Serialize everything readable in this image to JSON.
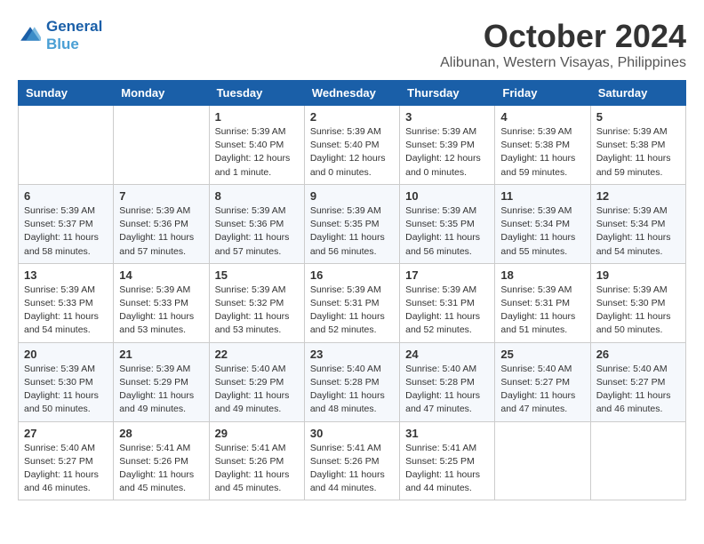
{
  "logo": {
    "line1": "General",
    "line2": "Blue"
  },
  "title": "October 2024",
  "location": "Alibunan, Western Visayas, Philippines",
  "weekdays": [
    "Sunday",
    "Monday",
    "Tuesday",
    "Wednesday",
    "Thursday",
    "Friday",
    "Saturday"
  ],
  "weeks": [
    [
      {
        "day": null
      },
      {
        "day": null
      },
      {
        "day": "1",
        "sunrise": "5:39 AM",
        "sunset": "5:40 PM",
        "daylight": "12 hours and 1 minute."
      },
      {
        "day": "2",
        "sunrise": "5:39 AM",
        "sunset": "5:40 PM",
        "daylight": "12 hours and 0 minutes."
      },
      {
        "day": "3",
        "sunrise": "5:39 AM",
        "sunset": "5:39 PM",
        "daylight": "12 hours and 0 minutes."
      },
      {
        "day": "4",
        "sunrise": "5:39 AM",
        "sunset": "5:38 PM",
        "daylight": "11 hours and 59 minutes."
      },
      {
        "day": "5",
        "sunrise": "5:39 AM",
        "sunset": "5:38 PM",
        "daylight": "11 hours and 59 minutes."
      }
    ],
    [
      {
        "day": "6",
        "sunrise": "5:39 AM",
        "sunset": "5:37 PM",
        "daylight": "11 hours and 58 minutes."
      },
      {
        "day": "7",
        "sunrise": "5:39 AM",
        "sunset": "5:36 PM",
        "daylight": "11 hours and 57 minutes."
      },
      {
        "day": "8",
        "sunrise": "5:39 AM",
        "sunset": "5:36 PM",
        "daylight": "11 hours and 57 minutes."
      },
      {
        "day": "9",
        "sunrise": "5:39 AM",
        "sunset": "5:35 PM",
        "daylight": "11 hours and 56 minutes."
      },
      {
        "day": "10",
        "sunrise": "5:39 AM",
        "sunset": "5:35 PM",
        "daylight": "11 hours and 56 minutes."
      },
      {
        "day": "11",
        "sunrise": "5:39 AM",
        "sunset": "5:34 PM",
        "daylight": "11 hours and 55 minutes."
      },
      {
        "day": "12",
        "sunrise": "5:39 AM",
        "sunset": "5:34 PM",
        "daylight": "11 hours and 54 minutes."
      }
    ],
    [
      {
        "day": "13",
        "sunrise": "5:39 AM",
        "sunset": "5:33 PM",
        "daylight": "11 hours and 54 minutes."
      },
      {
        "day": "14",
        "sunrise": "5:39 AM",
        "sunset": "5:33 PM",
        "daylight": "11 hours and 53 minutes."
      },
      {
        "day": "15",
        "sunrise": "5:39 AM",
        "sunset": "5:32 PM",
        "daylight": "11 hours and 53 minutes."
      },
      {
        "day": "16",
        "sunrise": "5:39 AM",
        "sunset": "5:31 PM",
        "daylight": "11 hours and 52 minutes."
      },
      {
        "day": "17",
        "sunrise": "5:39 AM",
        "sunset": "5:31 PM",
        "daylight": "11 hours and 52 minutes."
      },
      {
        "day": "18",
        "sunrise": "5:39 AM",
        "sunset": "5:31 PM",
        "daylight": "11 hours and 51 minutes."
      },
      {
        "day": "19",
        "sunrise": "5:39 AM",
        "sunset": "5:30 PM",
        "daylight": "11 hours and 50 minutes."
      }
    ],
    [
      {
        "day": "20",
        "sunrise": "5:39 AM",
        "sunset": "5:30 PM",
        "daylight": "11 hours and 50 minutes."
      },
      {
        "day": "21",
        "sunrise": "5:39 AM",
        "sunset": "5:29 PM",
        "daylight": "11 hours and 49 minutes."
      },
      {
        "day": "22",
        "sunrise": "5:40 AM",
        "sunset": "5:29 PM",
        "daylight": "11 hours and 49 minutes."
      },
      {
        "day": "23",
        "sunrise": "5:40 AM",
        "sunset": "5:28 PM",
        "daylight": "11 hours and 48 minutes."
      },
      {
        "day": "24",
        "sunrise": "5:40 AM",
        "sunset": "5:28 PM",
        "daylight": "11 hours and 47 minutes."
      },
      {
        "day": "25",
        "sunrise": "5:40 AM",
        "sunset": "5:27 PM",
        "daylight": "11 hours and 47 minutes."
      },
      {
        "day": "26",
        "sunrise": "5:40 AM",
        "sunset": "5:27 PM",
        "daylight": "11 hours and 46 minutes."
      }
    ],
    [
      {
        "day": "27",
        "sunrise": "5:40 AM",
        "sunset": "5:27 PM",
        "daylight": "11 hours and 46 minutes."
      },
      {
        "day": "28",
        "sunrise": "5:41 AM",
        "sunset": "5:26 PM",
        "daylight": "11 hours and 45 minutes."
      },
      {
        "day": "29",
        "sunrise": "5:41 AM",
        "sunset": "5:26 PM",
        "daylight": "11 hours and 45 minutes."
      },
      {
        "day": "30",
        "sunrise": "5:41 AM",
        "sunset": "5:26 PM",
        "daylight": "11 hours and 44 minutes."
      },
      {
        "day": "31",
        "sunrise": "5:41 AM",
        "sunset": "5:25 PM",
        "daylight": "11 hours and 44 minutes."
      },
      {
        "day": null
      },
      {
        "day": null
      }
    ]
  ],
  "labels": {
    "sunrise_prefix": "Sunrise: ",
    "sunset_prefix": "Sunset: ",
    "daylight_prefix": "Daylight: "
  }
}
